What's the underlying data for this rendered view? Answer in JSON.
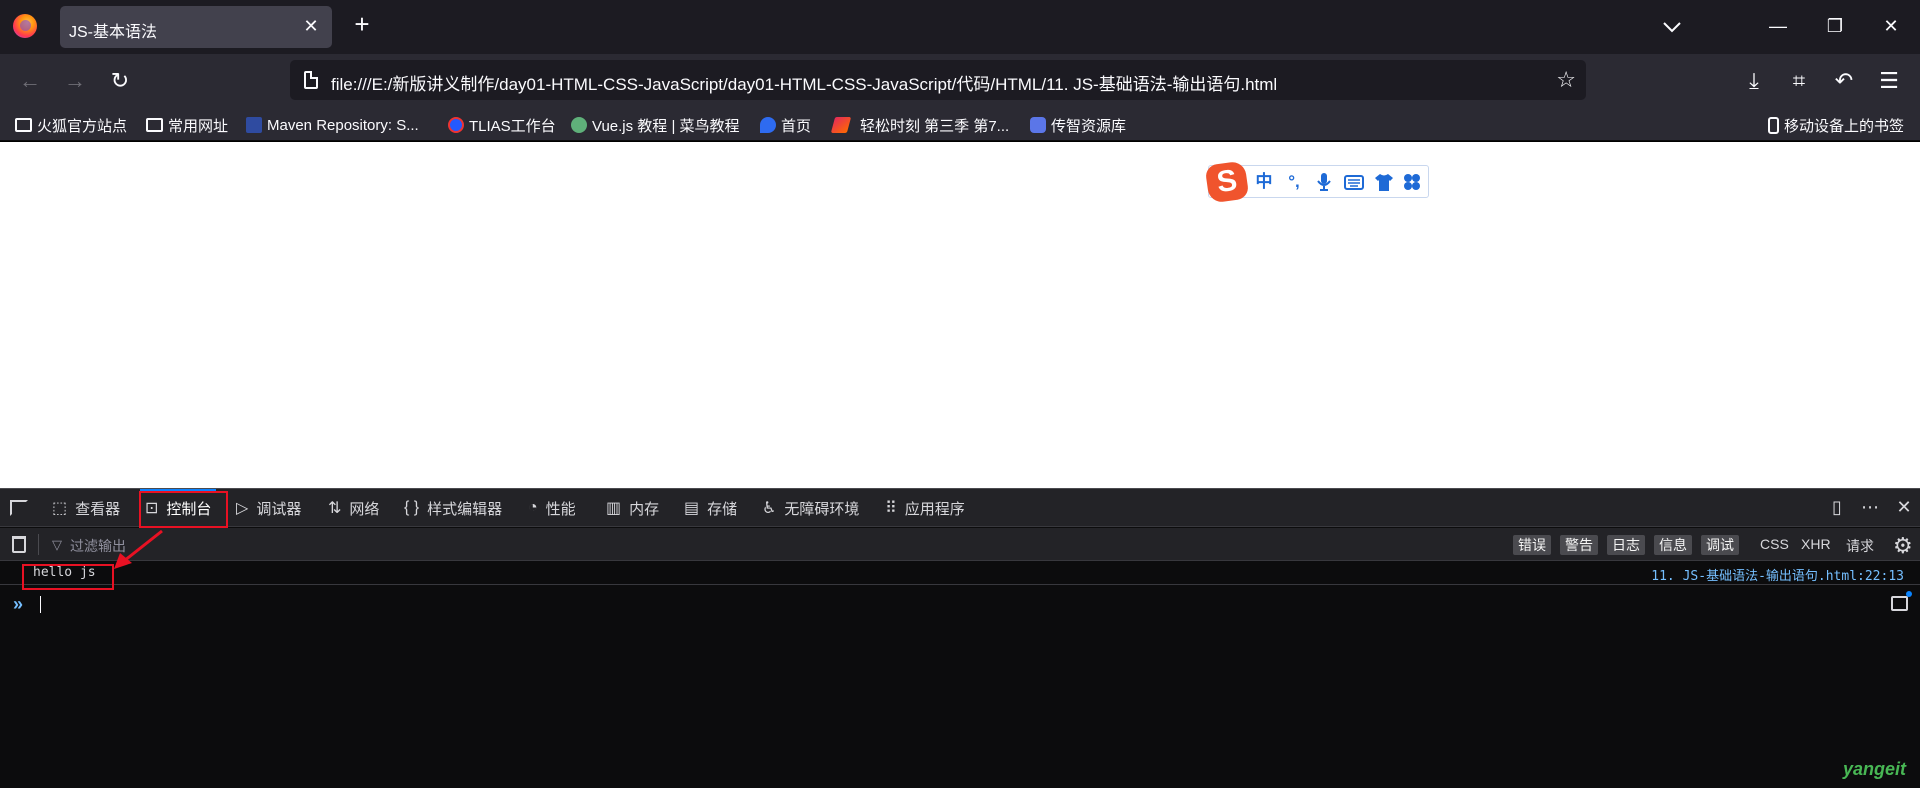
{
  "tabbar": {
    "tab_title": "JS-基本语法",
    "close_glyph": "✕",
    "new_tab_glyph": "+",
    "window": {
      "minimize": "—",
      "restore": "❐",
      "close": "✕"
    }
  },
  "navbar": {
    "back": "←",
    "forward": "→",
    "reload": "↻",
    "url": "file:///E:/新版讲义制作/day01-HTML-CSS-JavaScript/day01-HTML-CSS-JavaScript/代码/HTML/11. JS-基础语法-输出语句.html",
    "star": "☆",
    "downloads": "⤓",
    "screenshot": "⌗",
    "undo": "↶",
    "menu": "☰"
  },
  "bookmarks": {
    "items": [
      {
        "label": "火狐官方站点",
        "icon": "folder-icon"
      },
      {
        "label": "常用网址",
        "icon": "folder-icon"
      },
      {
        "label": "Maven Repository: S...",
        "icon": "maven-icon"
      },
      {
        "label": "TLIAS工作台",
        "icon": "tlias-icon"
      },
      {
        "label": "Vue.js 教程 | 菜鸟教程",
        "icon": "runoob-icon"
      },
      {
        "label": "首页",
        "icon": "baidu-icon"
      },
      {
        "label": "轻松时刻 第三季 第7...",
        "icon": "video-icon"
      },
      {
        "label": "传智资源库",
        "icon": "database-icon"
      }
    ],
    "mobile": "移动设备上的书签"
  },
  "ime": {
    "logo": "S",
    "items": [
      "中",
      "°,",
      "🎤",
      "⌨",
      "👕",
      "✤"
    ]
  },
  "devtools": {
    "tabs": [
      {
        "label": "查看器",
        "icon": "⬚"
      },
      {
        "label": "控制台",
        "icon": "⊡"
      },
      {
        "label": "调试器",
        "icon": "▷"
      },
      {
        "label": "网络",
        "icon": "⇅"
      },
      {
        "label": "样式编辑器",
        "icon": "{ }"
      },
      {
        "label": "性能",
        "icon": "◔"
      },
      {
        "label": "内存",
        "icon": "▥"
      },
      {
        "label": "存储",
        "icon": "▤"
      },
      {
        "label": "无障碍环境",
        "icon": "♿"
      },
      {
        "label": "应用程序",
        "icon": "⠿"
      }
    ],
    "active_tab": "控制台",
    "filter_placeholder": "过滤输出",
    "levels": [
      "错误",
      "警告",
      "日志",
      "信息",
      "调试"
    ],
    "filters": [
      "CSS",
      "XHR",
      "请求"
    ],
    "message": {
      "text": "hello js",
      "source": "11. JS-基础语法-输出语句.html:22:13"
    },
    "prompt": "»"
  },
  "watermark": "yangeit",
  "colors": {
    "tab_bg": "#1c1b22",
    "toolbar_bg": "#2b2a33",
    "devtools_bg": "#0c0c0d",
    "accent_blue": "#0a84ff",
    "annotation_red": "#e81123",
    "source_link": "#75bfff"
  }
}
